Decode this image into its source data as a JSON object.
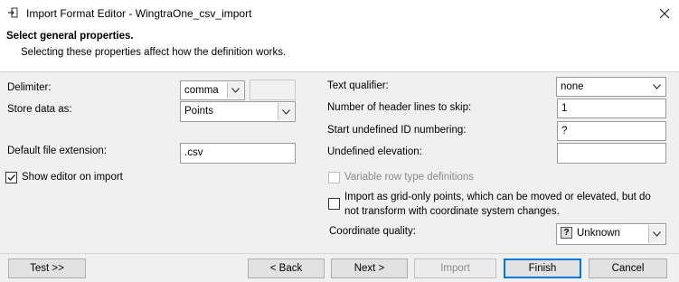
{
  "window": {
    "title": "Import Format Editor - WingtraOne_csv_import"
  },
  "header": {
    "title": "Select general properties.",
    "subtitle": "Selecting these properties affect how the definition works."
  },
  "left": {
    "delimiter_label": "Delimiter:",
    "delimiter_value": "comma",
    "delimiter_custom_value": "",
    "store_label": "Store data as:",
    "store_value": "Points",
    "ext_label": "Default file extension:",
    "ext_value": ".csv",
    "show_editor_label": "Show editor on import",
    "show_editor_checked": true
  },
  "right": {
    "text_qualifier_label": "Text qualifier:",
    "text_qualifier_value": "none",
    "header_lines_label": "Number of header lines to skip:",
    "header_lines_value": "1",
    "start_id_label": "Start undefined ID numbering:",
    "start_id_value": "?",
    "undef_elev_label": "Undefined elevation:",
    "undef_elev_value": "",
    "variable_row_label": "Variable row type definitions",
    "grid_only_label_1": "Import as grid-only points, which can be moved or elevated, but do",
    "grid_only_label_2": "not transform with coordinate system changes.",
    "coord_quality_label": "Coordinate quality:",
    "coord_quality_value": "Unknown"
  },
  "footer": {
    "test_label": "Test >>",
    "back_label": "< Back",
    "next_label": "Next >",
    "import_label": "Import",
    "finish_label": "Finish",
    "cancel_label": "Cancel"
  },
  "colors": {
    "body_bg": "#f0f0f0",
    "default_button_border": "#0078d7"
  }
}
